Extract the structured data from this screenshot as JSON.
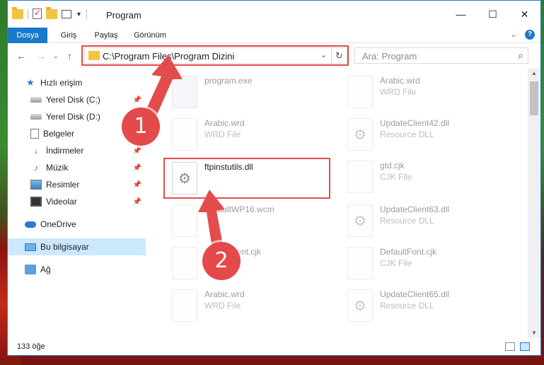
{
  "window": {
    "title": "Program",
    "controls": {
      "minimize": "—",
      "maximize": "☐",
      "close": "✕"
    }
  },
  "ribbon": {
    "tabs": [
      "Dosya",
      "Giriş",
      "Paylaş",
      "Görünüm"
    ],
    "help": "?"
  },
  "address_bar": {
    "path": "C:\\Program Files\\Program Dizini",
    "search_placeholder": "Ara: Program"
  },
  "sidebar": {
    "items": [
      {
        "label": "Hızlı erişim",
        "icon": "star-icon",
        "pinned": false
      },
      {
        "label": "Yerel Disk (C:)",
        "icon": "disk-icon",
        "pinned": true
      },
      {
        "label": "Yerel Disk (D:)",
        "icon": "disk-icon",
        "pinned": true
      },
      {
        "label": "Belgeler",
        "icon": "document-icon",
        "pinned": true
      },
      {
        "label": "İndirmeler",
        "icon": "download-icon",
        "pinned": true
      },
      {
        "label": "Müzik",
        "icon": "music-icon",
        "pinned": true
      },
      {
        "label": "Resimler",
        "icon": "pictures-icon",
        "pinned": true
      },
      {
        "label": "Videolar",
        "icon": "videos-icon",
        "pinned": true
      },
      {
        "label": "OneDrive",
        "icon": "cloud-icon",
        "pinned": false
      },
      {
        "label": "Bu bilgisayar",
        "icon": "computer-icon",
        "pinned": false,
        "selected": true
      },
      {
        "label": "Ağ",
        "icon": "network-icon",
        "pinned": false
      }
    ]
  },
  "files": [
    {
      "name": "program.exe",
      "type": "",
      "icon": "exe-icon",
      "faded": true
    },
    {
      "name": "Arabic.wrd",
      "type": "WRD File",
      "icon": "file-icon",
      "faded": true
    },
    {
      "name": "Arabic.wrd",
      "type": "WRD File",
      "icon": "file-icon",
      "faded": true
    },
    {
      "name": "UpdateClient42.dll",
      "type": "Resource DLL",
      "icon": "dll-icon",
      "faded": true
    },
    {
      "name": "ftpinstutils.dll",
      "type": "",
      "icon": "dll-icon",
      "faded": false,
      "highlighted": true
    },
    {
      "name": "gtd.cjk",
      "type": "CJK File",
      "icon": "file-icon",
      "faded": true
    },
    {
      "name": "DefaultWP16.wcm",
      "type": "",
      "icon": "file-icon",
      "faded": true
    },
    {
      "name": "UpdateClient63.dll",
      "type": "Resource DLL",
      "icon": "dll-icon",
      "faded": true
    },
    {
      "name": "DefaultFont.cjk",
      "type": "",
      "icon": "file-icon",
      "faded": true
    },
    {
      "name": "DefaultFont.cjk",
      "type": "CJK File",
      "icon": "file-icon",
      "faded": true
    },
    {
      "name": "Arabic.wrd",
      "type": "WRD File",
      "icon": "file-icon",
      "faded": true
    },
    {
      "name": "UpdateClient65.dll",
      "type": "Resource DLL",
      "icon": "dll-icon",
      "faded": true
    }
  ],
  "status": {
    "item_count": "133 öğe"
  },
  "callouts": [
    {
      "number": "1"
    },
    {
      "number": "2"
    }
  ],
  "colors": {
    "accent": "#1979ca",
    "callout_red": "#e34c4c",
    "selected_bg": "#cce8ff"
  }
}
